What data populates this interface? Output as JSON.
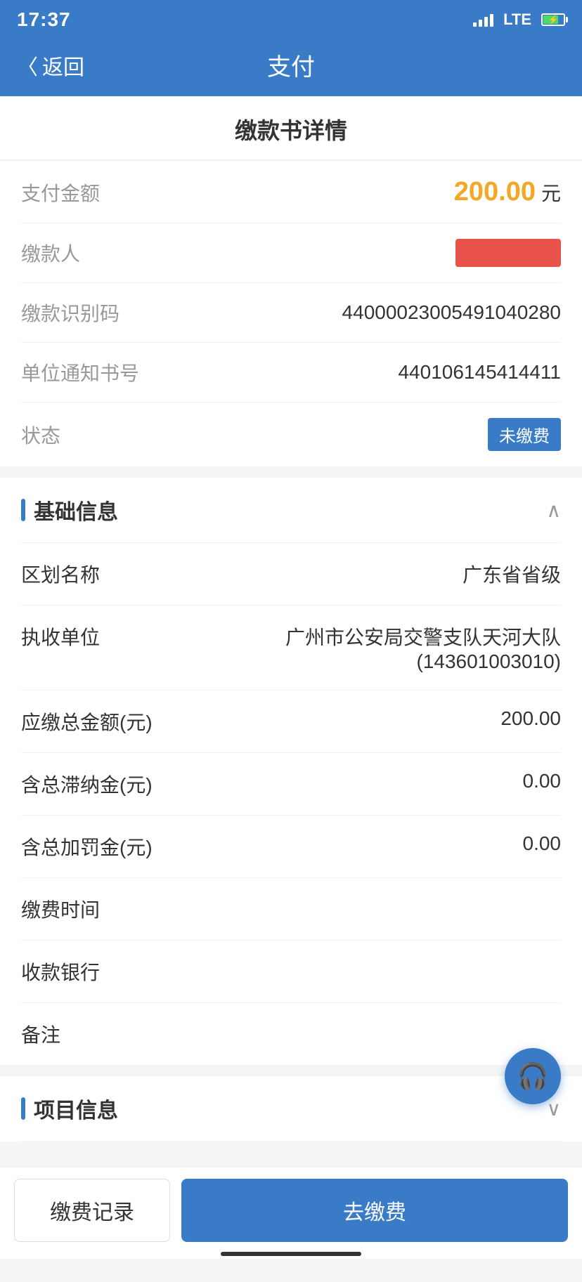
{
  "statusBar": {
    "time": "17:37",
    "hasLocation": true
  },
  "navBar": {
    "backLabel": "返回",
    "title": "支付"
  },
  "pageTitle": "缴款书详情",
  "details": {
    "amountLabel": "支付金额",
    "amountValue": "200.00",
    "amountUnit": "元",
    "payerLabel": "缴款人",
    "codeLabel": "缴款识别码",
    "codeValue": "44000023005491040280",
    "noticeLabel": "单位通知书号",
    "noticeValue": "440106145414411",
    "statusLabel": "状态",
    "statusValue": "未缴费"
  },
  "basicInfo": {
    "sectionTitle": "基础信息",
    "rows": [
      {
        "label": "区划名称",
        "value": "广东省省级"
      },
      {
        "label": "执收单位",
        "value": "广州市公安局交警支队天河大队\n(143601003010)"
      },
      {
        "label": "应缴总金额(元)",
        "value": "200.00"
      },
      {
        "label": "含总滞纳金(元)",
        "value": "0.00"
      },
      {
        "label": "含总加罚金(元)",
        "value": "0.00"
      },
      {
        "label": "缴费时间",
        "value": ""
      },
      {
        "label": "收款银行",
        "value": ""
      },
      {
        "label": "备注",
        "value": ""
      }
    ]
  },
  "projectInfo": {
    "sectionTitle": "项目信息"
  },
  "bottomBar": {
    "recordLabel": "缴费记录",
    "payLabel": "去缴费"
  }
}
